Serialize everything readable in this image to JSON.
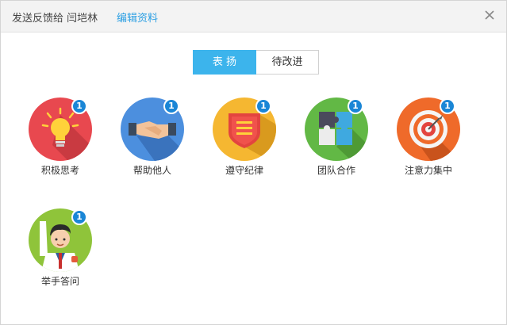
{
  "header": {
    "title": "发送反馈给 闫垲林",
    "edit_link": "编辑资料"
  },
  "tabs": [
    {
      "label": "表 扬",
      "active": true
    },
    {
      "label": "待改进",
      "active": false
    }
  ],
  "badges": [
    {
      "label": "积极思考",
      "count": "1",
      "icon": "lightbulb-icon",
      "color": "#e8484f"
    },
    {
      "label": "帮助他人",
      "count": "1",
      "icon": "handshake-icon",
      "color": "#4c8fde"
    },
    {
      "label": "遵守纪律",
      "count": "1",
      "icon": "shield-icon",
      "color": "#f5b731"
    },
    {
      "label": "团队合作",
      "count": "1",
      "icon": "puzzle-icon",
      "color": "#62b845"
    },
    {
      "label": "注意力集中",
      "count": "1",
      "icon": "target-icon",
      "color": "#ef6a2a"
    },
    {
      "label": "举手答问",
      "count": "1",
      "icon": "raise-hand-icon",
      "color": "#8fc43a"
    }
  ]
}
